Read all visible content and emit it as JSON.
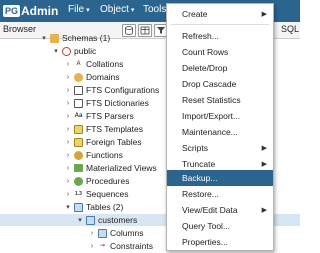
{
  "app": {
    "logo_pg": "PG",
    "logo_admin": "Admin"
  },
  "menubar": [
    {
      "label": "File",
      "caret": "▾"
    },
    {
      "label": "Object",
      "caret": "▾"
    },
    {
      "label": "Tools",
      "caret": ""
    }
  ],
  "toolbar": {
    "browser_label": "Browser",
    "sql_label": "SQL"
  },
  "tree": [
    {
      "label": "Schemas (1)",
      "arrow": "▾",
      "icon": "schemas-icon"
    },
    {
      "label": "public",
      "arrow": "▾",
      "icon": "schema-icon"
    },
    {
      "label": "Collations",
      "arrow": "›",
      "icon": "collations-icon"
    },
    {
      "label": "Domains",
      "arrow": "›",
      "icon": "domains-icon"
    },
    {
      "label": "FTS Configurations",
      "arrow": "›",
      "icon": "fts-configurations-icon"
    },
    {
      "label": "FTS Dictionaries",
      "arrow": "›",
      "icon": "fts-dictionaries-icon"
    },
    {
      "label": "FTS Parsers",
      "arrow": "›",
      "icon": "fts-parsers-icon"
    },
    {
      "label": "FTS Templates",
      "arrow": "›",
      "icon": "fts-templates-icon"
    },
    {
      "label": "Foreign Tables",
      "arrow": "›",
      "icon": "foreign-tables-icon"
    },
    {
      "label": "Functions",
      "arrow": "›",
      "icon": "functions-icon"
    },
    {
      "label": "Materialized Views",
      "arrow": "›",
      "icon": "materialized-views-icon"
    },
    {
      "label": "Procedures",
      "arrow": "›",
      "icon": "procedures-icon"
    },
    {
      "label": "Sequences",
      "arrow": "›",
      "icon": "sequences-icon"
    },
    {
      "label": "Tables (2)",
      "arrow": "▾",
      "icon": "tables-icon"
    },
    {
      "label": "customers",
      "arrow": "▾",
      "icon": "table-icon",
      "selected": true
    },
    {
      "label": "Columns",
      "arrow": "›",
      "icon": "columns-icon"
    },
    {
      "label": "Constraints",
      "arrow": "›",
      "icon": "constraints-icon"
    }
  ],
  "context_menu": [
    {
      "label": "Create",
      "submenu": true
    },
    {
      "label": "Refresh..."
    },
    {
      "label": "Count Rows"
    },
    {
      "label": "Delete/Drop"
    },
    {
      "label": "Drop Cascade"
    },
    {
      "label": "Reset Statistics"
    },
    {
      "label": "Import/Export..."
    },
    {
      "label": "Maintenance..."
    },
    {
      "label": "Scripts",
      "submenu": true
    },
    {
      "label": "Truncate",
      "submenu": true
    },
    {
      "label": "Backup...",
      "highlighted": true
    },
    {
      "label": "Restore..."
    },
    {
      "label": "View/Edit Data",
      "submenu": true
    },
    {
      "label": "Query Tool..."
    },
    {
      "label": "Properties..."
    }
  ],
  "colors": {
    "brand": "#2c6490",
    "selected_row": "#d8e6f3",
    "menu_highlight": "#2c6490"
  }
}
